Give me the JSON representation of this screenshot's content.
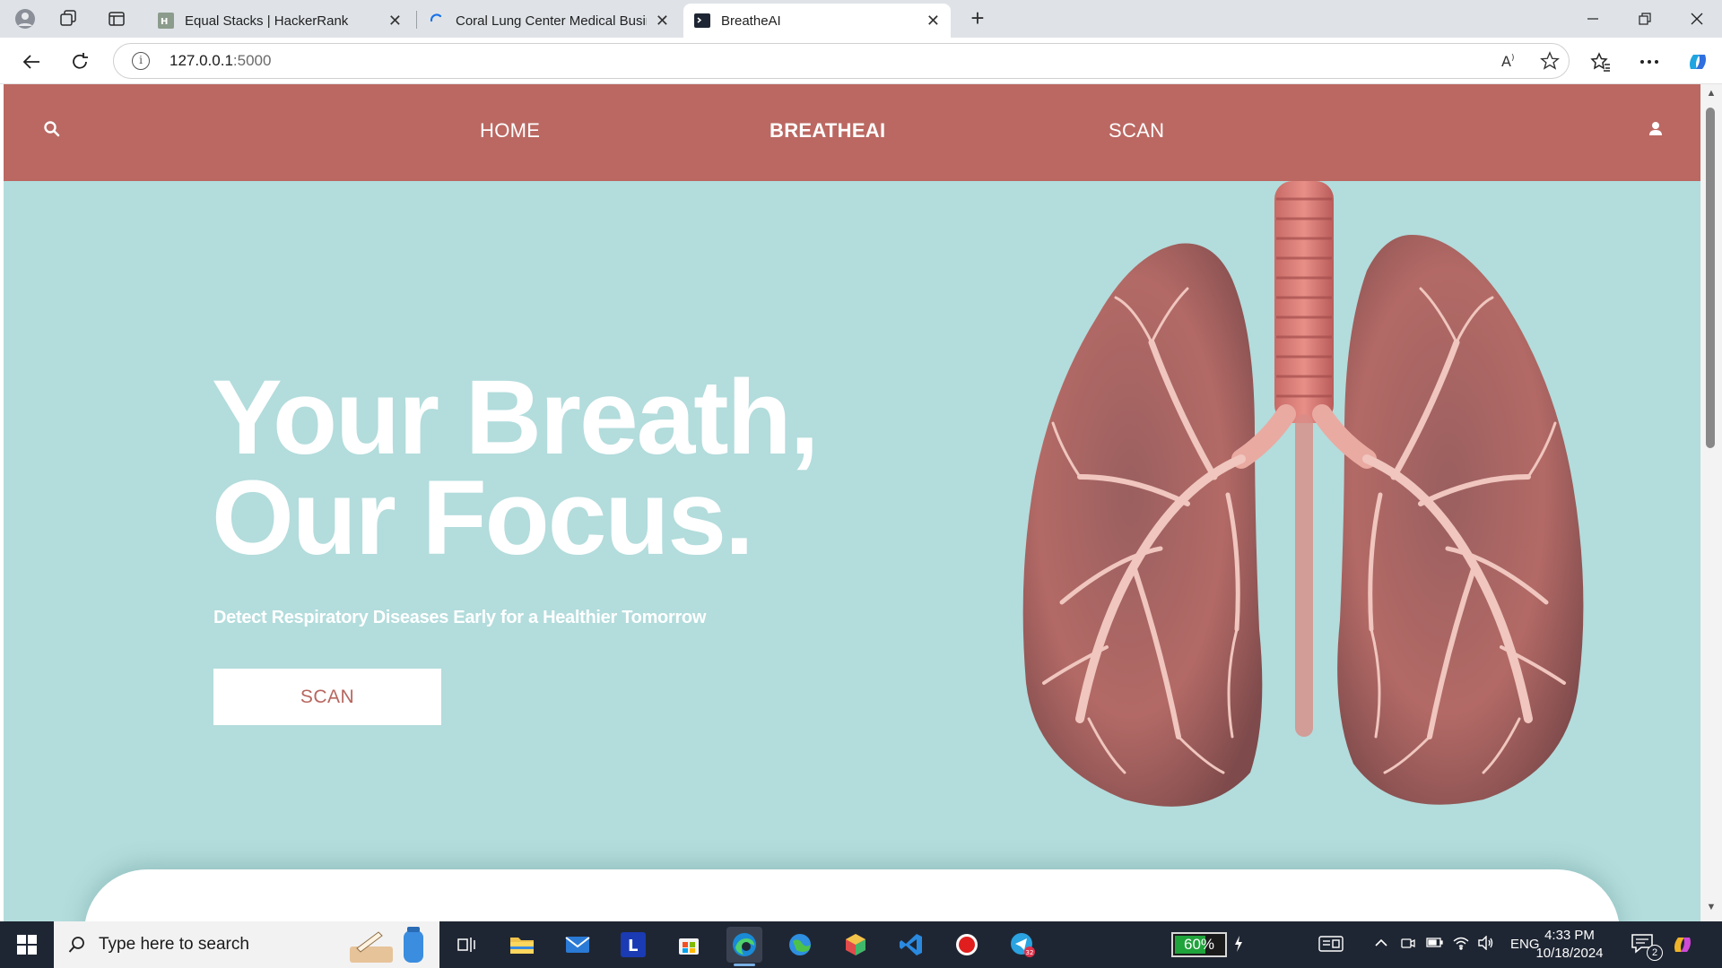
{
  "browser": {
    "tabs": [
      {
        "title": "Equal Stacks | HackerRank",
        "state": "inactive"
      },
      {
        "title": "Coral Lung Center Medical Busine",
        "state": "loading"
      },
      {
        "title": "BreatheAI",
        "state": "active"
      }
    ],
    "address": {
      "host": "127.0.0.1",
      "port": ":5000"
    }
  },
  "site": {
    "nav": {
      "home": "HOME",
      "brand": "BREATHEAI",
      "scan": "SCAN"
    },
    "hero": {
      "title_line1": "Your Breath,",
      "title_line2": "Our Focus.",
      "subtitle": "Detect Respiratory Diseases Early for a Healthier Tomorrow",
      "button": "SCAN"
    },
    "colors": {
      "nav_bg": "#bb6862",
      "hero_bg": "#b3dcdc",
      "button_text": "#b7665f"
    }
  },
  "taskbar": {
    "search_placeholder": "Type here to search",
    "battery": "60%",
    "language": "ENG",
    "time": "4:33 PM",
    "date": "10/18/2024",
    "notifications": "2",
    "telegram_badge": "32"
  }
}
